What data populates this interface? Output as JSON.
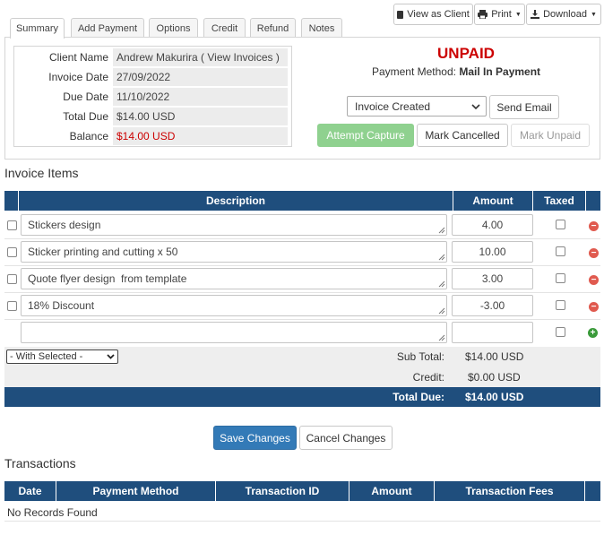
{
  "top_buttons": {
    "view_as_client": "View as Client",
    "print": "Print",
    "download": "Download"
  },
  "tabs": [
    {
      "label": "Summary"
    },
    {
      "label": "Add Payment"
    },
    {
      "label": "Options"
    },
    {
      "label": "Credit"
    },
    {
      "label": "Refund"
    },
    {
      "label": "Notes"
    }
  ],
  "summary": {
    "client_name_label": "Client Name",
    "client_name": "Andrew Makurira",
    "view_invoices_link": "( View Invoices )",
    "invoice_date_label": "Invoice Date",
    "invoice_date": "27/09/2022",
    "due_date_label": "Due Date",
    "due_date": "11/10/2022",
    "total_due_label": "Total Due",
    "total_due": "$14.00 USD",
    "balance_label": "Balance",
    "balance": "$14.00 USD"
  },
  "status": {
    "label": "UNPAID",
    "color": "#cc0000",
    "payment_method_label": "Payment Method:",
    "payment_method": "Mail In Payment"
  },
  "actions": {
    "template_select": "Invoice Created",
    "send_email": "Send Email",
    "attempt_capture": "Attempt Capture",
    "mark_cancelled": "Mark Cancelled",
    "mark_unpaid": "Mark Unpaid"
  },
  "invoice_items": {
    "heading": "Invoice Items",
    "headers": {
      "description": "Description",
      "amount": "Amount",
      "taxed": "Taxed"
    },
    "rows": [
      {
        "description": "Stickers design",
        "amount": "4.00"
      },
      {
        "description": "Sticker printing and cutting x 50",
        "amount": "10.00"
      },
      {
        "description": "Quote flyer design  from template",
        "amount": "3.00"
      },
      {
        "description": "18% Discount",
        "amount": "-3.00"
      }
    ],
    "new_row": {
      "description": "",
      "amount": ""
    },
    "with_selected": "- With Selected -",
    "sub_total_label": "Sub Total:",
    "sub_total": "$14.00 USD",
    "credit_label": "Credit:",
    "credit": "$0.00 USD",
    "total_due_label": "Total Due:",
    "total_due": "$14.00 USD"
  },
  "form_buttons": {
    "save": "Save Changes",
    "cancel": "Cancel Changes"
  },
  "transactions": {
    "heading": "Transactions",
    "headers": {
      "date": "Date",
      "payment_method": "Payment Method",
      "transaction_id": "Transaction ID",
      "amount": "Amount",
      "fees": "Transaction Fees"
    },
    "empty_text": "No Records Found"
  },
  "colors": {
    "header_blue": "#1f4e7d",
    "primary_blue": "#337ab7",
    "success_green": "#8fd18f",
    "remove_red": "#e05a4f",
    "add_green": "#3a9a3a"
  }
}
